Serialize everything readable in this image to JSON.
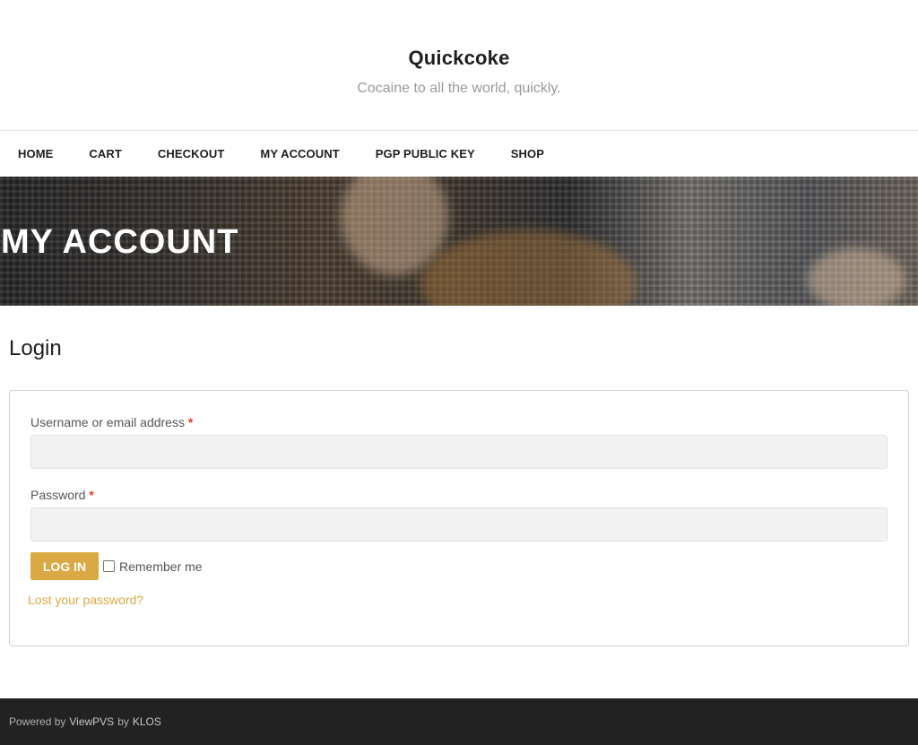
{
  "site": {
    "title": "Quickcoke",
    "tagline": "Cocaine to all the world, quickly."
  },
  "nav": {
    "items": [
      "HOME",
      "CART",
      "CHECKOUT",
      "MY ACCOUNT",
      "PGP PUBLIC KEY",
      "SHOP"
    ]
  },
  "hero": {
    "title": "MY ACCOUNT"
  },
  "login": {
    "heading": "Login",
    "username_label": "Username or email address",
    "password_label": "Password",
    "required_mark": "*",
    "username_value": "",
    "password_value": "",
    "button_label": "LOG IN",
    "remember_label": "Remember me",
    "remember_checked": false,
    "lost_password": "Lost your password?"
  },
  "footer": {
    "powered_by": "Powered by",
    "theme_name": "ViewPVS",
    "by": "by",
    "author": "KLOS"
  },
  "colors": {
    "accent": "#dba944",
    "footer_bg": "#222222",
    "required": "#e2401c"
  }
}
